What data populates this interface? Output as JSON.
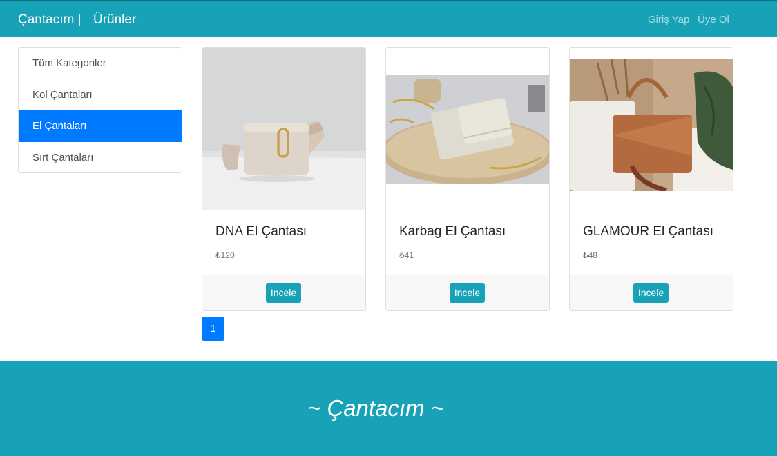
{
  "navbar": {
    "brand": "Çantacım |",
    "products": "Ürünler",
    "login": "Giriş Yap",
    "signup": "Üye Ol"
  },
  "sidebar": {
    "items": [
      {
        "label": "Tüm Kategoriler",
        "active": false
      },
      {
        "label": "Kol Çantaları",
        "active": false
      },
      {
        "label": "El Çantaları",
        "active": true
      },
      {
        "label": "Sırt Çantaları",
        "active": false
      }
    ]
  },
  "products": [
    {
      "title": "DNA El Çantası",
      "price": "₺120",
      "button": "İncele"
    },
    {
      "title": "Karbag El Çantası",
      "price": "₺41",
      "button": "İncele"
    },
    {
      "title": "GLAMOUR El Çantası",
      "price": "₺48",
      "button": "İncele"
    }
  ],
  "pagination": {
    "current": "1"
  },
  "footer": {
    "text": "~ Çantacım ~"
  },
  "colors": {
    "primary": "#007bff",
    "info": "#17a2b8"
  }
}
